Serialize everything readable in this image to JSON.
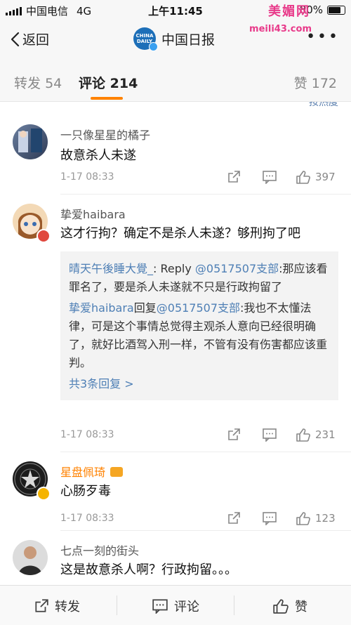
{
  "status": {
    "carrier": "中国电信",
    "network": "4G",
    "time": "上午11:45",
    "battery": "80%"
  },
  "watermark": {
    "text": "美媚网",
    "url": "meili43.com"
  },
  "nav": {
    "back_label": "返回",
    "title": "中国日报",
    "logo_text_1": "CHINA",
    "logo_text_2": "DAILY"
  },
  "tabs": [
    {
      "label": "转发",
      "count": "54"
    },
    {
      "label": "评论",
      "count": "214"
    },
    {
      "label": "赞",
      "count": "172"
    }
  ],
  "cutoff_text": "按热度",
  "comments": [
    {
      "name": "一只像星星的橘子",
      "text": "故意杀人未遂",
      "time": "1-17 08:33",
      "likes": "397"
    },
    {
      "name": "挚爱haibara",
      "text": "这才行拘？确定不是杀人未遂？够刑拘了吧",
      "time": "1-17 08:33",
      "likes": "231",
      "replies": [
        {
          "author": "晴天午後睡大覺_",
          "prefix": ": Reply ",
          "mention": "@0517507支部",
          "body": ":那应该看罪名了，要是杀人未遂就不只是行政拘留了"
        },
        {
          "author": "挚爱haibara",
          "prefix": "回复",
          "mention": "@0517507支部",
          "body": ":我也不太懂法律，可是这个事情总觉得主观杀人意向已经很明确了，就好比酒驾入刑一样，不管有没有伤害都应该重判。"
        }
      ],
      "more_replies": "共3条回复 >"
    },
    {
      "name": "星盘佩琦",
      "text": "心肠歹毒",
      "time": "1-17 08:33",
      "likes": "123"
    },
    {
      "name": "七点一刻的街头",
      "text": "这是故意杀人啊？行政拘留。。。"
    }
  ],
  "bottom_bar": {
    "repost": "转发",
    "comment": "评论",
    "like": "赞"
  },
  "colors": {
    "accent": "#ff8200",
    "link": "#4e7fb5",
    "watermark": "#e83a8a"
  }
}
